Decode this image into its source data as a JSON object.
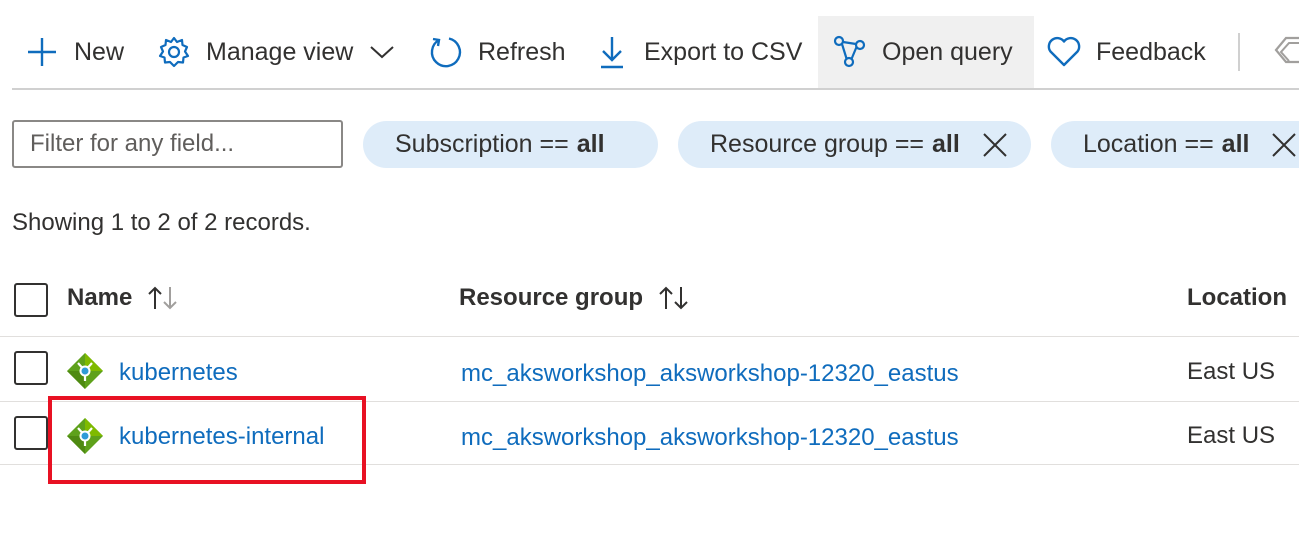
{
  "toolbar": {
    "new_label": "New",
    "manage_view_label": "Manage view",
    "refresh_label": "Refresh",
    "export_label": "Export to CSV",
    "open_query_label": "Open query",
    "feedback_label": "Feedback"
  },
  "filter": {
    "placeholder": "Filter for any field...",
    "pills": [
      {
        "field": "Subscription ==",
        "value": "all"
      },
      {
        "field": "Resource group ==",
        "value": "all"
      },
      {
        "field": "Location ==",
        "value": "all"
      }
    ]
  },
  "records_text": "Showing 1 to 2 of 2 records.",
  "table": {
    "columns": [
      "Name",
      "Resource group",
      "Location"
    ],
    "rows": [
      {
        "name": "kubernetes",
        "resource_group": "mc_aksworkshop_aksworkshop-12320_eastus",
        "location": "East US"
      },
      {
        "name": "kubernetes-internal",
        "resource_group": "mc_aksworkshop_aksworkshop-12320_eastus",
        "location": "East US"
      }
    ]
  },
  "colors": {
    "accent": "#0f6cbd",
    "pill_bg": "#deecf9",
    "highlight": "#e81123",
    "lb_green": "#5ea11b"
  },
  "icons": {
    "lb": "load-balancer-icon"
  }
}
